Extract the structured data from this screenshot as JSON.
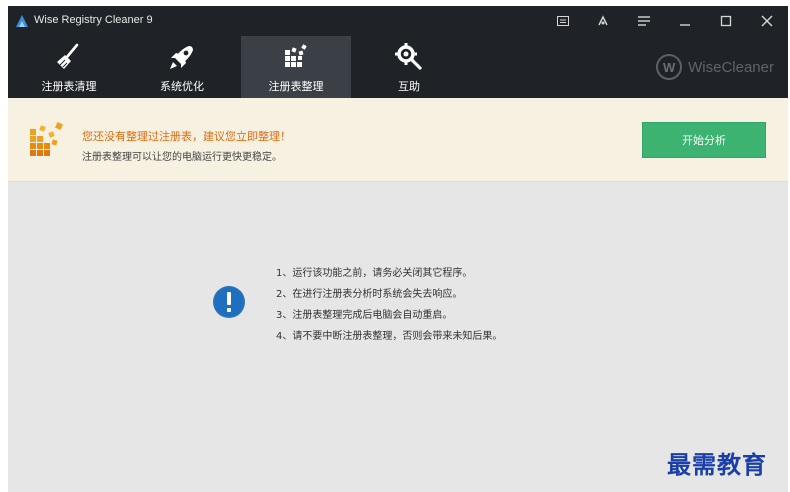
{
  "window": {
    "title": "Wise Registry Cleaner 9"
  },
  "titlebar_buttons": [
    {
      "icon": "feedback-icon"
    },
    {
      "icon": "skin-icon"
    },
    {
      "icon": "menu-icon"
    },
    {
      "icon": "minimize-icon"
    },
    {
      "icon": "maximize-icon"
    },
    {
      "icon": "close-icon"
    }
  ],
  "toolbar": {
    "tabs": [
      {
        "label": "注册表清理",
        "icon": "broom-icon",
        "active": false
      },
      {
        "label": "系统优化",
        "icon": "rocket-icon",
        "active": false
      },
      {
        "label": "注册表整理",
        "icon": "blocks-icon",
        "active": true
      },
      {
        "label": "互助",
        "icon": "tools-icon",
        "active": false
      }
    ],
    "brand": {
      "mark": "W",
      "name": "WiseCleaner"
    }
  },
  "notice": {
    "title": "您还没有整理过注册表，建议您立即整理！",
    "subtitle": "注册表整理可以让您的电脑运行更快更稳定。",
    "start_button": "开始分析",
    "accent_color": "#e06b10",
    "button_color": "#3cb371"
  },
  "tips": [
    "1、运行该功能之前，请务必关闭其它程序。",
    "2、在进行注册表分析时系统会失去响应。",
    "3、注册表整理完成后电脑会自动重启。",
    "4、请不要中断注册表整理，否则会带来未知后果。"
  ],
  "watermark": "最需教育"
}
